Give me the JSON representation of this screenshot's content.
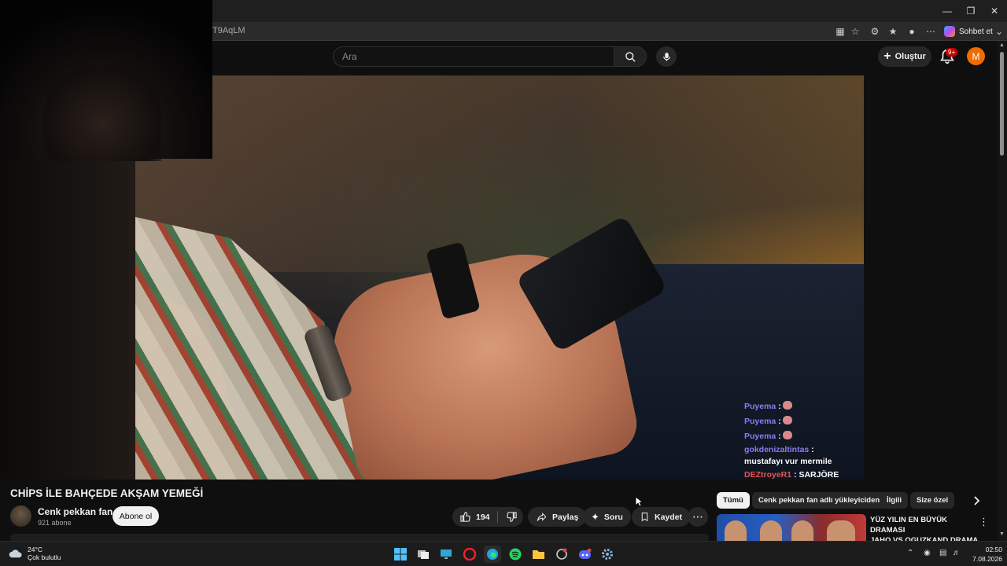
{
  "browser": {
    "url_fragment": "T9AqLM",
    "chat_button_label": "Sohbet et",
    "window_controls": [
      "minimize",
      "restore",
      "close"
    ]
  },
  "header": {
    "search_placeholder": "Ara",
    "create_label": "Oluştur",
    "notification_badge": "9+",
    "avatar_letter": "M"
  },
  "video": {
    "title": "CHİPS İLE BAHÇEDE AKŞAM YEMEĞİ",
    "channel_name": "Cenk pekkan fan",
    "subscribers": "921 abone",
    "subscribe_label": "Abone ol",
    "like_count": "194",
    "share_label": "Paylaş",
    "ask_label": "Soru",
    "save_label": "Kaydet"
  },
  "chat_overlay": [
    {
      "user": "Puyema",
      "sep": " :",
      "message": "",
      "emoji": true
    },
    {
      "user": "Puyema",
      "sep": " :",
      "message": "",
      "emoji": true
    },
    {
      "user": "Puyema",
      "sep": " :",
      "message": "",
      "emoji": true
    },
    {
      "user": "gokdenizaltintas",
      "sep": " :",
      "message": "mustafayı vur mermile",
      "emoji": false
    },
    {
      "user": "DEZtroyeR1",
      "sep": " :",
      "message": "SARJÖRE",
      "emoji": false
    }
  ],
  "chips": [
    "Tümü",
    "Cenk pekkan fan adlı yükleyiciden",
    "İlgili",
    "Size özel"
  ],
  "recommended": {
    "title_line1": "YÜZ YILIN EN BÜYÜK DRAMASI",
    "title_line2": "JAHO VS OGUZKAND DRAMA ..."
  },
  "taskbar": {
    "temperature": "24°C",
    "weather_desc": "Çok bulutlu",
    "time": "02:50",
    "date": "7.08.2026"
  },
  "colors": {
    "background": "#0f0f0f",
    "chip_active": "#f1f1f1",
    "avatar": "#ef6c00",
    "badge": "#cc0000",
    "chat_user": "#8a7cf0"
  }
}
